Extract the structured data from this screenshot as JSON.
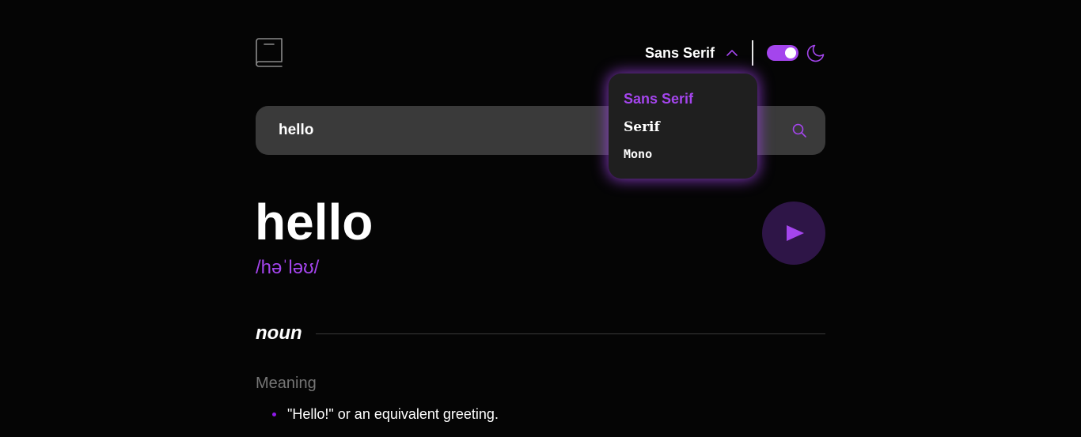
{
  "header": {
    "logo_icon": "book-icon",
    "font_selector": {
      "selected_label": "Sans Serif",
      "chevron_icon": "chevron-up-icon"
    },
    "theme_toggle": {
      "state": "on",
      "icon": "moon-icon"
    }
  },
  "font_dropdown": {
    "options": [
      {
        "label": "Sans Serif",
        "active": true
      },
      {
        "label": "Serif",
        "active": false
      },
      {
        "label": "Mono",
        "active": false
      }
    ]
  },
  "search": {
    "value": "hello",
    "icon": "search-icon"
  },
  "entry": {
    "word": "hello",
    "phonetic": "/həˈləʊ/",
    "play_icon": "play-icon",
    "meanings": [
      {
        "part_of_speech": "noun",
        "label": "Meaning",
        "definitions": [
          "\"Hello!\" or an equivalent greeting."
        ]
      }
    ]
  },
  "colors": {
    "accent": "#a445ed",
    "background": "#050505",
    "surface": "#3a3a3a",
    "dropdown_bg": "#1f1f1f",
    "muted_text": "#757575"
  }
}
